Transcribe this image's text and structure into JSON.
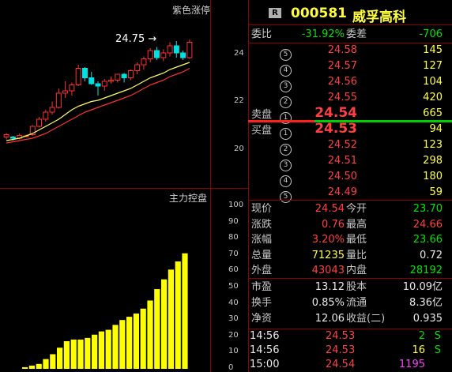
{
  "chart_panel": {
    "title": "紫色涨停",
    "high_label": "24.75",
    "y_ticks": [
      "24",
      "22",
      "20"
    ]
  },
  "chart_data": [
    {
      "type": "bar",
      "title": "主力控盘",
      "ylim": [
        0,
        100
      ],
      "y_ticks": [
        100,
        90,
        80,
        70,
        60,
        50,
        40,
        30,
        20,
        10,
        0
      ],
      "values": [
        1,
        2,
        3,
        6,
        9,
        13,
        17,
        18,
        18,
        19,
        21,
        23,
        24,
        27,
        30,
        32,
        34,
        37,
        42,
        49,
        55,
        61,
        66,
        71
      ],
      "color": "#ffff00"
    }
  ],
  "stock": {
    "badge": "R",
    "code": "000581",
    "name": "威孚高科"
  },
  "commission": {
    "ratio_label": "委比",
    "ratio_value": "-31.92%",
    "diff_label": "委差",
    "diff_value": "-706"
  },
  "sell": {
    "label": "卖盘",
    "levels": [
      {
        "num": "5",
        "price": "24.58",
        "vol": "145"
      },
      {
        "num": "4",
        "price": "24.57",
        "vol": "127"
      },
      {
        "num": "3",
        "price": "24.56",
        "vol": "104"
      },
      {
        "num": "2",
        "price": "24.55",
        "vol": "420"
      },
      {
        "num": "1",
        "price": "24.54",
        "vol": "665"
      }
    ]
  },
  "buy": {
    "label": "买盘",
    "levels": [
      {
        "num": "1",
        "price": "24.53",
        "vol": "94"
      },
      {
        "num": "2",
        "price": "24.52",
        "vol": "123"
      },
      {
        "num": "3",
        "price": "24.51",
        "vol": "298"
      },
      {
        "num": "4",
        "price": "24.50",
        "vol": "180"
      },
      {
        "num": "5",
        "price": "24.49",
        "vol": "59"
      }
    ]
  },
  "quote": [
    {
      "l1": "现价",
      "v1": "24.54",
      "c1": "red",
      "l2": "今开",
      "v2": "23.70",
      "c2": "grn"
    },
    {
      "l1": "涨跌",
      "v1": "0.76",
      "c1": "red",
      "l2": "最高",
      "v2": "24.66",
      "c2": "red"
    },
    {
      "l1": "涨幅",
      "v1": "3.20%",
      "c1": "red",
      "l2": "最低",
      "v2": "23.66",
      "c2": "grn"
    },
    {
      "l1": "总量",
      "v1": "71235",
      "c1": "yel",
      "l2": "量比",
      "v2": "0.72",
      "c2": "wht"
    },
    {
      "l1": "外盘",
      "v1": "43043",
      "c1": "red",
      "l2": "内盘",
      "v2": "28192",
      "c2": "grn"
    }
  ],
  "fund": [
    {
      "l1": "市盈",
      "v1": "13.12",
      "l2": "股本",
      "v2": "10.09亿"
    },
    {
      "l1": "换手",
      "v1": "0.85%",
      "l2": "流通",
      "v2": "8.36亿"
    },
    {
      "l1": "净资",
      "v1": "12.06",
      "l2": "收益(二)",
      "v2": "0.935"
    }
  ],
  "ticks": [
    {
      "time": "14:56",
      "price": "24.53",
      "vol": "2",
      "vc": "grn",
      "flag": "S",
      "fc": "grn"
    },
    {
      "time": "14:56",
      "price": "24.53",
      "vol": "16",
      "vc": "yel",
      "flag": "S",
      "fc": "grn"
    },
    {
      "time": "15:00",
      "price": "24.54",
      "vol": "1195",
      "vc": "mag",
      "flag": "",
      "fc": "grn"
    }
  ],
  "colors": {
    "up": "#ff4040",
    "down": "#00e000",
    "grid": "#8a0000",
    "bar": "#ffff00",
    "ma5": "#ffff60",
    "ma10": "#ff3030"
  }
}
